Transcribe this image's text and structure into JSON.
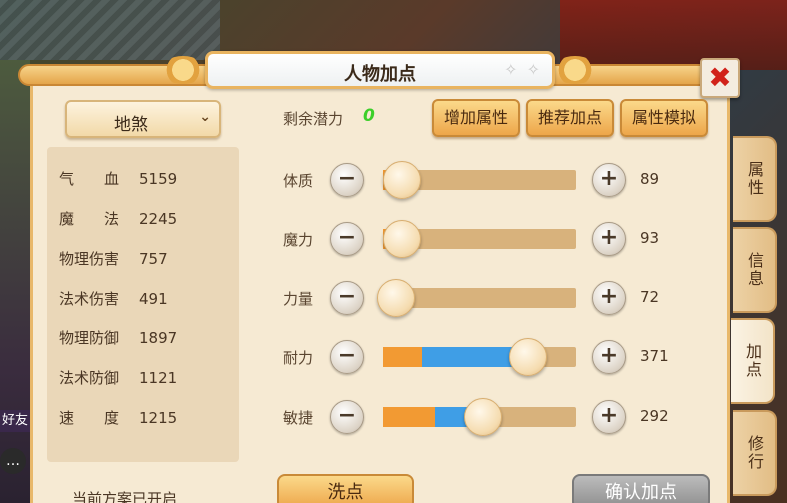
{
  "window": {
    "title": "人物加点",
    "close_icon": "close-icon"
  },
  "scheme": {
    "selected": "地煞",
    "note": "当前方案已开启"
  },
  "stats": [
    {
      "label": "气　　血",
      "value": "5159"
    },
    {
      "label": "魔　　法",
      "value": "2245"
    },
    {
      "label": "物理伤害",
      "value": "757"
    },
    {
      "label": "法术伤害",
      "value": "491"
    },
    {
      "label": "物理防御",
      "value": "1897"
    },
    {
      "label": "法术防御",
      "value": "1121"
    },
    {
      "label": "速　　度",
      "value": "1215"
    }
  ],
  "potential": {
    "label": "剩余潜力",
    "value": "0"
  },
  "top_buttons": {
    "add_attr": "增加属性",
    "recommend": "推荐加点",
    "simulate": "属性模拟"
  },
  "attributes": [
    {
      "name": "体质",
      "value": "89",
      "base_fraction": 0.05,
      "added_fraction": 0.0
    },
    {
      "name": "魔力",
      "value": "93",
      "base_fraction": 0.05,
      "added_fraction": 0.0
    },
    {
      "name": "力量",
      "value": "72",
      "base_fraction": 0.02,
      "added_fraction": 0.0
    },
    {
      "name": "耐力",
      "value": "371",
      "base_fraction": 0.2,
      "added_fraction": 0.5
    },
    {
      "name": "敏捷",
      "value": "292",
      "base_fraction": 0.27,
      "added_fraction": 0.2
    }
  ],
  "bottom_buttons": {
    "wash": "洗点",
    "confirm": "确认加点"
  },
  "side_tabs": [
    {
      "label": "属性",
      "active": false
    },
    {
      "label": "信息",
      "active": false
    },
    {
      "label": "加点",
      "active": true
    },
    {
      "label": "修行",
      "active": false
    }
  ],
  "overlay": {
    "friend_label": "好友"
  },
  "colors": {
    "panel_bg": "#f6ead3",
    "accent_orange": "#f29a33",
    "accent_blue": "#3f9ee6",
    "potential_green": "#3ccf2a",
    "close_red": "#d1221a"
  }
}
